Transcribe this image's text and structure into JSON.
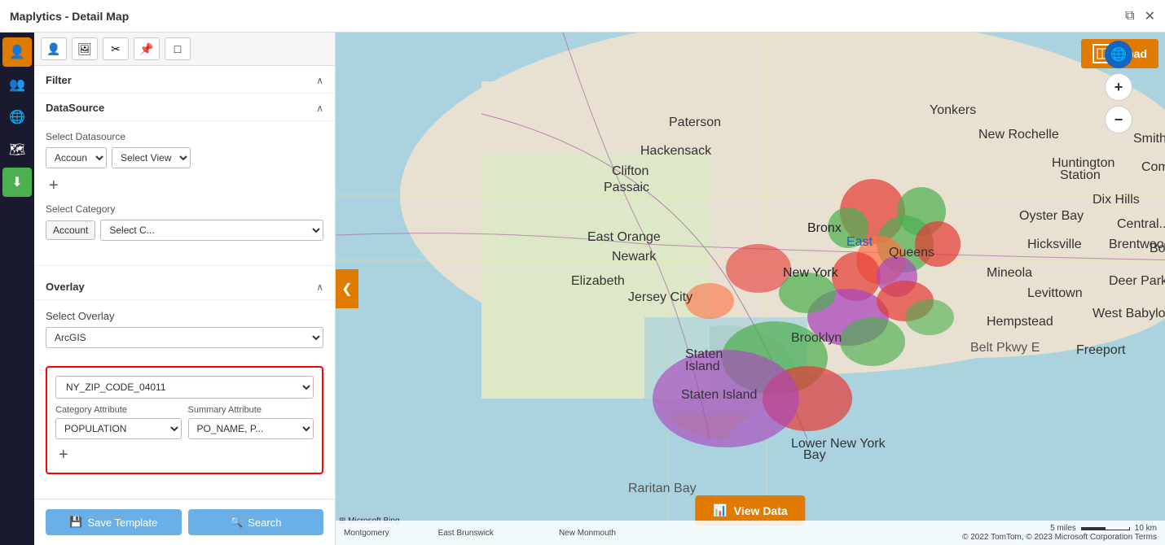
{
  "titlebar": {
    "title": "Maplytics - Detail Map",
    "restore_btn": "⧉",
    "close_btn": "✕"
  },
  "icon_rail": {
    "buttons": [
      {
        "icon": "👤",
        "label": "person-icon",
        "active": true
      },
      {
        "icon": "👥",
        "label": "group-icon",
        "active": false
      },
      {
        "icon": "🔵",
        "label": "circle-icon",
        "active": false
      },
      {
        "icon": "🗺️",
        "label": "map-icon",
        "active": false
      },
      {
        "icon": "⬇",
        "label": "download-icon",
        "active": false
      }
    ]
  },
  "panel": {
    "tabs": [
      {
        "icon": "👤",
        "label": "person-tab",
        "active": false
      },
      {
        "icon": "🖼",
        "label": "image-tab",
        "active": false
      },
      {
        "icon": "✂",
        "label": "cut-tab",
        "active": false
      },
      {
        "icon": "📌",
        "label": "pin-tab",
        "active": false
      },
      {
        "icon": "□",
        "label": "square-tab",
        "active": false
      }
    ],
    "filter_section": {
      "title": "Filter",
      "chevron": "∧"
    },
    "datasource_section": {
      "title": "DataSource",
      "chevron": "∧",
      "select_datasource_label": "Select Datasource",
      "account_dropdown": "Accoun ▾",
      "view_dropdown": "Select View ▾",
      "plus": "+",
      "select_category_label": "Select Category",
      "category_account": "Account",
      "select_c_dropdown": "Select C... ▾"
    },
    "overlay_section": {
      "title": "Overlay",
      "chevron": "∧",
      "select_overlay_label": "Select Overlay",
      "arcgis_dropdown": "ArcGIS",
      "zip_code_value": "NY_ZIP_CODE_04011",
      "category_attribute_label": "Category Attribute",
      "summary_attribute_label": "Summary Attribute",
      "population_dropdown": "POPULATION",
      "po_name_dropdown": "PO_NAME, P...",
      "plus": "+"
    },
    "footer": {
      "save_label": "Save Template",
      "save_icon": "💾",
      "search_label": "Search",
      "search_icon": "🔍"
    }
  },
  "map": {
    "road_badge_label": "Road",
    "view_data_label": "View Data",
    "view_data_icon": "📊",
    "left_arrow": "❮",
    "right_arrow": "❯",
    "zoom_in": "+",
    "zoom_out": "−",
    "copyright": "© 2022 TomTom, © 2023 Microsoft Corporation   Terms",
    "bing_logo": "Microsoft Bing",
    "scale_miles": "5 miles",
    "scale_km": "10 km"
  }
}
